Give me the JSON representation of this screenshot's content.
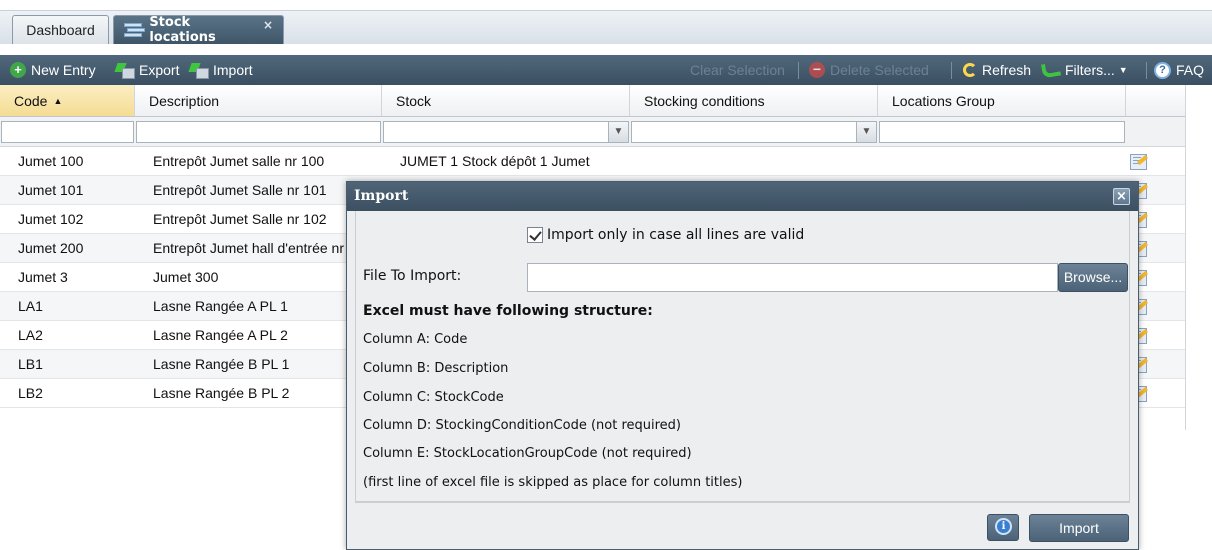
{
  "tabs": [
    {
      "label": "Dashboard"
    },
    {
      "label": "Stock locations",
      "close": "×"
    }
  ],
  "toolbar": {
    "new_entry": "New Entry",
    "export": "Export",
    "import": "Import",
    "clear_selection": "Clear Selection",
    "delete_selected": "Delete Selected",
    "refresh": "Refresh",
    "filters": "Filters...",
    "faq": "FAQ"
  },
  "grid": {
    "columns": [
      "Code",
      "Description",
      "Stock",
      "Stocking conditions",
      "Locations Group"
    ],
    "sort_indicator": "▲",
    "rows": [
      {
        "code": "Jumet 100",
        "description": "Entrepôt Jumet salle nr 100",
        "stock": "JUMET 1 Stock dépôt 1 Jumet"
      },
      {
        "code": "Jumet 101",
        "description": "Entrepôt Jumet Salle nr 101",
        "stock": ""
      },
      {
        "code": "Jumet 102",
        "description": "Entrepôt Jumet Salle nr 102",
        "stock": ""
      },
      {
        "code": "Jumet 200",
        "description": "Entrepôt Jumet hall d'entrée nr",
        "stock": ""
      },
      {
        "code": "Jumet 3",
        "description": "Jumet 300",
        "stock": ""
      },
      {
        "code": "LA1",
        "description": "Lasne Rangée A PL 1",
        "stock": ""
      },
      {
        "code": "LA2",
        "description": "Lasne Rangée A PL 2",
        "stock": ""
      },
      {
        "code": "LB1",
        "description": "Lasne Rangée B PL 1",
        "stock": ""
      },
      {
        "code": "LB2",
        "description": "Lasne Rangée B PL 2",
        "stock": ""
      }
    ]
  },
  "dialog": {
    "title": "Import",
    "close": "×",
    "checkbox_label": "Import only in case all lines are valid",
    "file_label": "File To Import:",
    "file_value": "",
    "browse": "Browse...",
    "structure_title": "Excel must have following structure:",
    "structure_lines": [
      "Column A: Code",
      "Column B: Description",
      "Column C: StockCode",
      "Column D: StockingConditionCode (not required)",
      "Column E: StockLocationGroupCode (not required)",
      "(first line of excel file is skipped as place for column titles)"
    ],
    "info_icon": "i",
    "import_button": "Import"
  }
}
